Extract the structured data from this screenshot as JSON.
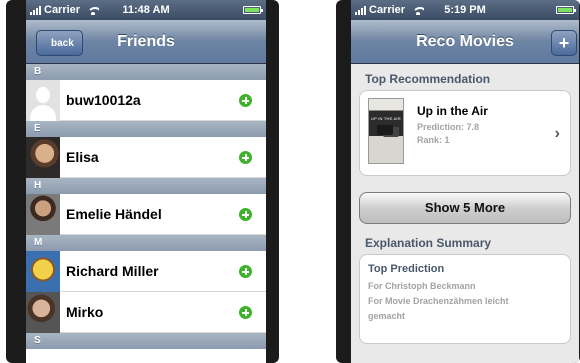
{
  "left_phone": {
    "status": {
      "carrier": "Carrier",
      "time": "11:48 AM"
    },
    "navbar": {
      "back_label": "back",
      "title": "Friends"
    },
    "sections": [
      {
        "letter": "B",
        "friends": [
          {
            "name": "buw10012a",
            "avatar": "default-avatar-icon"
          }
        ]
      },
      {
        "letter": "E",
        "friends": [
          {
            "name": "Elisa",
            "avatar": "photo"
          }
        ]
      },
      {
        "letter": "H",
        "friends": [
          {
            "name": "Emelie Händel",
            "avatar": "photo"
          }
        ]
      },
      {
        "letter": "M",
        "friends": [
          {
            "name": "Richard Miller",
            "avatar": "photo"
          },
          {
            "name": "Mirko",
            "avatar": "photo"
          }
        ]
      },
      {
        "letter": "S",
        "friends": []
      }
    ],
    "add_icon": "plus-circle-icon",
    "add_color": "#3fb22c"
  },
  "right_phone": {
    "status": {
      "carrier": "Carrier",
      "time": "5:19 PM"
    },
    "navbar": {
      "title": "Reco Movies",
      "add_label": "+"
    },
    "top_recommendation": {
      "heading": "Top Recommendation",
      "movie_title": "Up in the Air",
      "prediction": "Prediction: 7.8",
      "rank": "Rank: 1"
    },
    "show_more_label": "Show 5 More",
    "explanation": {
      "heading": "Explanation Summary",
      "card_title": "Top Prediction",
      "line1": "For Christoph Beckmann",
      "line2": "For Movie Drachenzähmen leicht",
      "line3": "gemacht"
    }
  }
}
